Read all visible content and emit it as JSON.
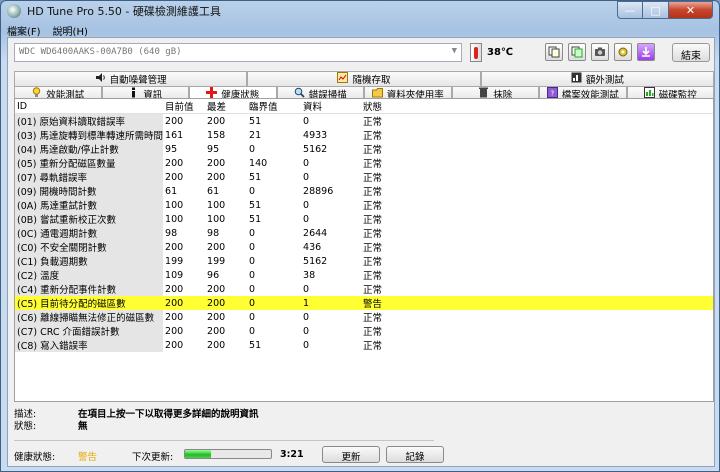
{
  "window": {
    "title": "HD Tune Pro 5.50 - 硬碟檢測維護工具"
  },
  "menu": [
    "檔案(F)",
    "說明(H)"
  ],
  "toolbar": {
    "drive": "WDC WD6400AAKS-00A7B0 (640 gB)",
    "temperature": "38℃",
    "exit_label": "結束",
    "icons": [
      "copy-icon",
      "copy-info-icon",
      "screenshot-icon",
      "options-icon",
      "download-icon"
    ]
  },
  "tabs_top": [
    {
      "label": "自動噪聲管理",
      "icon": "speaker-icon"
    },
    {
      "label": "隨機存取",
      "icon": "random-access-icon"
    },
    {
      "label": "額外測試",
      "icon": "extra-tests-icon"
    }
  ],
  "tabs_bottom": [
    {
      "label": "效能測試",
      "icon": "benchmark-icon"
    },
    {
      "label": "資訊",
      "icon": "info-icon"
    },
    {
      "label": "健康狀態",
      "icon": "health-icon",
      "active": true
    },
    {
      "label": "錯誤掃描",
      "icon": "error-scan-icon"
    },
    {
      "label": "資料夾使用率",
      "icon": "folder-usage-icon"
    },
    {
      "label": "抹除",
      "icon": "erase-icon"
    },
    {
      "label": "檔案效能測試",
      "icon": "file-benchmark-icon"
    },
    {
      "label": "磁碟監控",
      "icon": "disk-monitor-icon"
    }
  ],
  "table": {
    "headers": [
      "ID",
      "目前值",
      "最差",
      "臨界值",
      "資料",
      "狀態"
    ],
    "rows": [
      [
        "(01) 原始資料讀取錯誤率",
        "200",
        "200",
        "51",
        "0",
        "正常"
      ],
      [
        "(03) 馬達旋轉到標準轉速所需時間",
        "161",
        "158",
        "21",
        "4933",
        "正常"
      ],
      [
        "(04) 馬達啟動/停止計數",
        "95",
        "95",
        "0",
        "5162",
        "正常"
      ],
      [
        "(05) 重新分配磁區數量",
        "200",
        "200",
        "140",
        "0",
        "正常"
      ],
      [
        "(07) 尋軌錯誤率",
        "200",
        "200",
        "51",
        "0",
        "正常"
      ],
      [
        "(09) 開機時間計數",
        "61",
        "61",
        "0",
        "28896",
        "正常"
      ],
      [
        "(0A) 馬達重試計數",
        "100",
        "100",
        "51",
        "0",
        "正常"
      ],
      [
        "(0B) 嘗試重新校正次數",
        "100",
        "100",
        "51",
        "0",
        "正常"
      ],
      [
        "(0C) 通電週期計數",
        "98",
        "98",
        "0",
        "2644",
        "正常"
      ],
      [
        "(C0) 不安全關閉計數",
        "200",
        "200",
        "0",
        "436",
        "正常"
      ],
      [
        "(C1) 負載週期數",
        "199",
        "199",
        "0",
        "5162",
        "正常"
      ],
      [
        "(C2) 溫度",
        "109",
        "96",
        "0",
        "38",
        "正常"
      ],
      [
        "(C4) 重新分配事件計數",
        "200",
        "200",
        "0",
        "0",
        "正常"
      ],
      [
        "(C5) 目前待分配的磁區數",
        "200",
        "200",
        "0",
        "1",
        "警告"
      ],
      [
        "(C6) 離線掃瞄無法修正的磁區數",
        "200",
        "200",
        "0",
        "0",
        "正常"
      ],
      [
        "(C7) CRC 介面錯誤計數",
        "200",
        "200",
        "0",
        "0",
        "正常"
      ],
      [
        "(C8) 寫入錯誤率",
        "200",
        "200",
        "51",
        "0",
        "正常"
      ]
    ],
    "warning_row_index": 13
  },
  "info": {
    "desc_label": "描述:",
    "desc_value": "在項目上按一下以取得更多詳細的說明資訊",
    "status_label": "狀態:",
    "status_value": "無"
  },
  "statusbar": {
    "health_label": "健康狀態:",
    "health_value": "警告",
    "next_update_label": "下次更新:",
    "progress_fraction": 0.3,
    "time": "3:21",
    "update_button": "更新",
    "log_button": "記錄"
  },
  "colors": {
    "warning_row": "#ffff33",
    "health_warning_text": "#e6a800"
  }
}
